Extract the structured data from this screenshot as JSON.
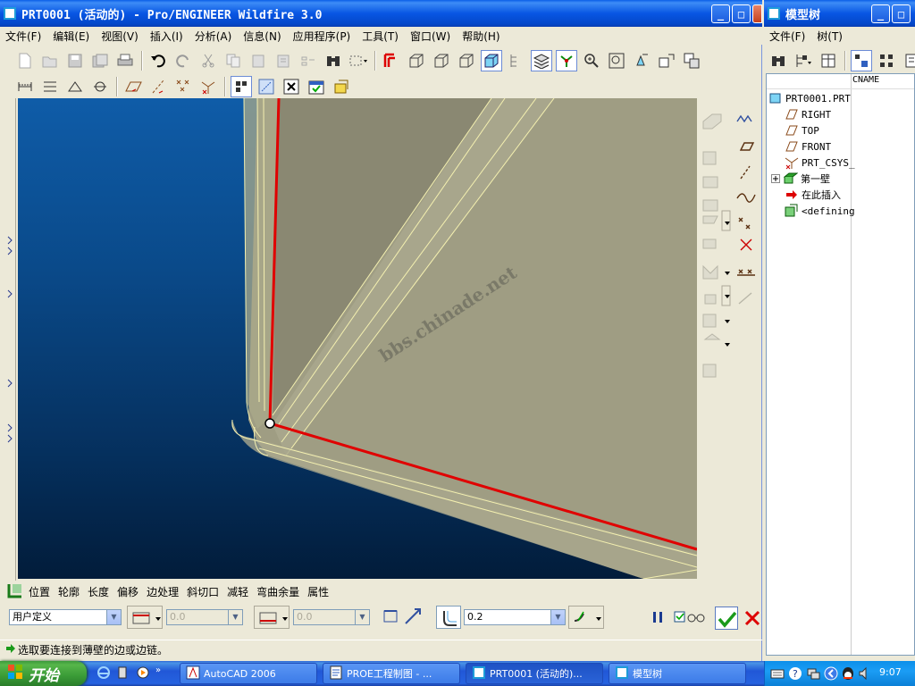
{
  "main_window": {
    "title": "PRT0001 (活动的) - Pro/ENGINEER Wildfire 3.0",
    "menu": [
      "文件(F)",
      "编辑(E)",
      "视图(V)",
      "插入(I)",
      "分析(A)",
      "信息(N)",
      "应用程序(P)",
      "工具(T)",
      "窗口(W)",
      "帮助(H)"
    ]
  },
  "viewport": {
    "watermark": "bbs.chinade.net"
  },
  "dashboard": {
    "tabs": [
      "位置",
      "轮廓",
      "长度",
      "偏移",
      "边处理",
      "斜切口",
      "减轻",
      "弯曲余量",
      "属性"
    ],
    "type_combo": "用户定义",
    "length1": "0.0",
    "length2": "0.0",
    "radius": "0.2"
  },
  "status": {
    "message": "选取要连接到薄壁的边或边链。"
  },
  "model_tree": {
    "title": "模型树",
    "menu": [
      "文件(F)",
      "树(T)"
    ],
    "column": "CNAME",
    "items": [
      "PRT0001.PRT",
      "RIGHT",
      "TOP",
      "FRONT",
      "PRT_CSYS_",
      "第一壁",
      "在此插入",
      "<defining"
    ]
  },
  "taskbar": {
    "start": "开始",
    "tasks": [
      "AutoCAD 2006",
      "PROE工程制图 - ...",
      "PRT0001 (活动的)...",
      "模型树"
    ],
    "clock": "9:07"
  },
  "colors": {
    "accent_red": "#e00000",
    "confirm_green": "#1a9a1a",
    "title_blue": "#0a5fe8"
  }
}
